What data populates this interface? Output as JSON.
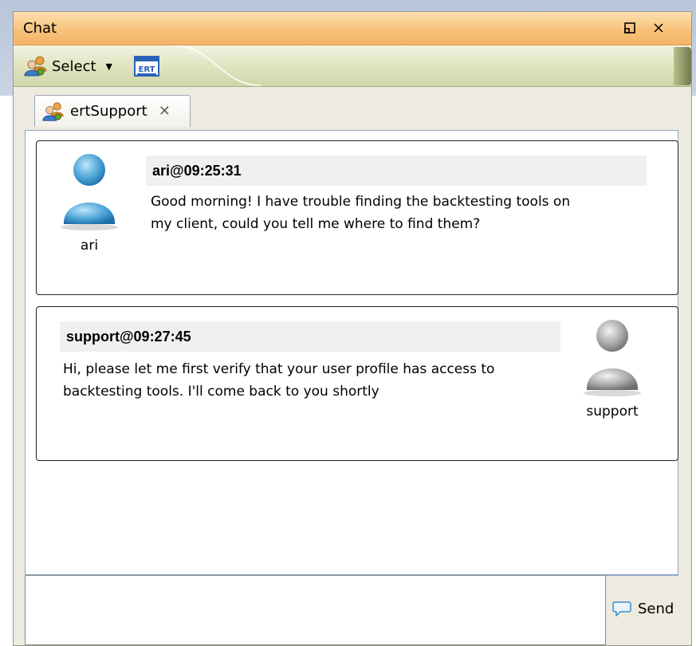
{
  "window": {
    "title": "Chat"
  },
  "toolbar": {
    "select_label": "Select",
    "ert_label": "ERT"
  },
  "tab": {
    "label": "ertSupport"
  },
  "messages": [
    {
      "header": "ari@09:25:31",
      "text_line1": "Good morning! I have trouble finding the backtesting tools on",
      "text_line2": "my client, could you tell me where to find them?",
      "avatar_name": "ari"
    },
    {
      "header": "support@09:27:45",
      "text_line1": "Hi, please let me first verify that your user profile has access to",
      "text_line2": "backtesting tools. I'll come back to you shortly",
      "avatar_name": "support"
    }
  ],
  "input": {
    "value": ""
  },
  "send": {
    "label": "Send"
  },
  "colors": {
    "titlebar": "#f7c27a",
    "toolbar": "#e2e6c4",
    "avatar_user": "#4aa3d6",
    "avatar_support": "#a8a8a8"
  }
}
